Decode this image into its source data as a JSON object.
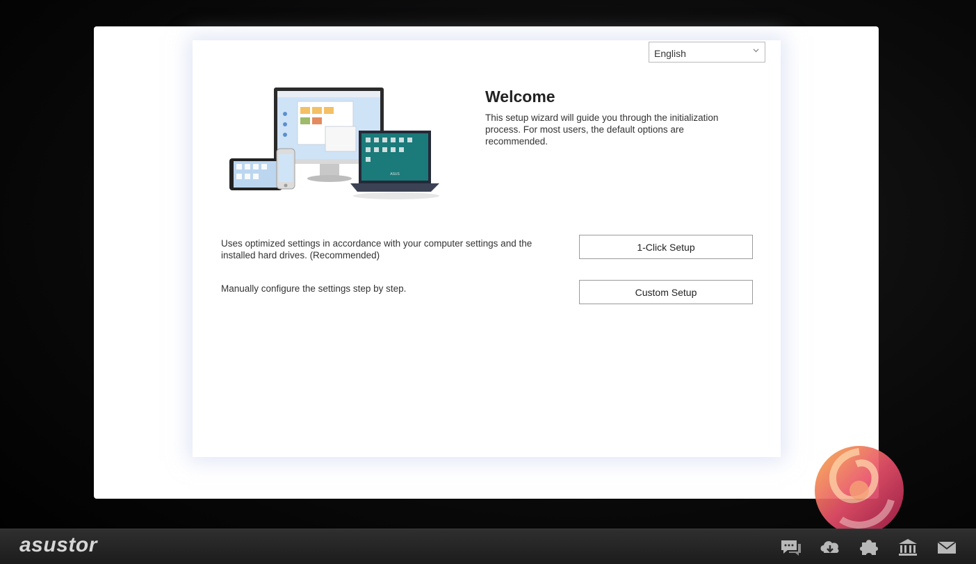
{
  "language_select": {
    "value": "English",
    "options": [
      "English"
    ]
  },
  "welcome": {
    "title": "Welcome",
    "text": "This setup wizard will guide you through the initialization process. For most users, the default options are recommended."
  },
  "options": [
    {
      "description": "Uses optimized settings in accordance with your computer settings and the installed hard drives. (Recommended)",
      "button": "1-Click Setup"
    },
    {
      "description": "Manually configure the settings step by step.",
      "button": "Custom Setup"
    }
  ],
  "taskbar": {
    "brand": "asustor",
    "icons": [
      "chat-icon",
      "cloud-download-icon",
      "puzzle-icon",
      "bank-icon",
      "mail-icon"
    ]
  },
  "hero_image": {
    "device_text": "ASUS"
  },
  "colors": {
    "accent_dark": "#1a1a1a",
    "taskbar": "#262626",
    "button_border": "#9a9a9a"
  }
}
